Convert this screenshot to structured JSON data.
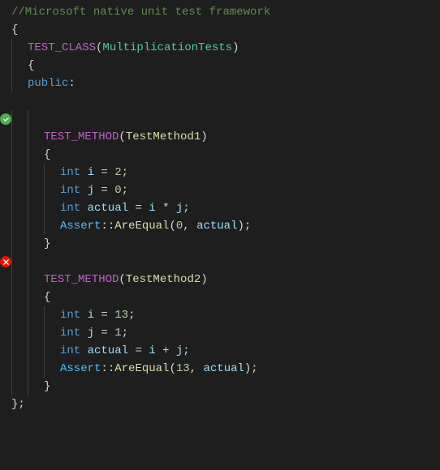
{
  "editor": {
    "background": "#1e1e1e",
    "lines": [
      {
        "id": 1,
        "indent": 0,
        "indicator": null,
        "tokens": [
          {
            "type": "comment",
            "text": "//Microsoft native unit test framework"
          }
        ]
      },
      {
        "id": 2,
        "indent": 0,
        "indicator": null,
        "tokens": [
          {
            "type": "text",
            "text": "{"
          }
        ]
      },
      {
        "id": 3,
        "indent": 1,
        "indicator": null,
        "tokens": [
          {
            "type": "macro",
            "text": "TEST_CLASS"
          },
          {
            "type": "text",
            "text": "("
          },
          {
            "type": "class",
            "text": "MultiplicationTests"
          },
          {
            "type": "text",
            "text": ")"
          }
        ]
      },
      {
        "id": 4,
        "indent": 1,
        "indicator": null,
        "tokens": [
          {
            "type": "text",
            "text": "{"
          }
        ]
      },
      {
        "id": 5,
        "indent": 1,
        "indicator": null,
        "tokens": [
          {
            "type": "keyword",
            "text": "public"
          },
          {
            "type": "text",
            "text": ":"
          }
        ]
      },
      {
        "id": 6,
        "indent": 0,
        "indicator": null,
        "tokens": []
      },
      {
        "id": 7,
        "indent": 2,
        "indicator": "pass",
        "tokens": []
      },
      {
        "id": 8,
        "indent": 2,
        "indicator": null,
        "tokens": [
          {
            "type": "macro",
            "text": "TEST_METHOD"
          },
          {
            "type": "text",
            "text": "("
          },
          {
            "type": "method",
            "text": "TestMethod1"
          },
          {
            "type": "text",
            "text": ")"
          }
        ]
      },
      {
        "id": 9,
        "indent": 2,
        "indicator": null,
        "tokens": [
          {
            "type": "text",
            "text": "{"
          }
        ]
      },
      {
        "id": 10,
        "indent": 3,
        "indicator": null,
        "tokens": [
          {
            "type": "keyword",
            "text": "int"
          },
          {
            "type": "text",
            "text": " "
          },
          {
            "type": "var",
            "text": "i"
          },
          {
            "type": "text",
            "text": " = "
          },
          {
            "type": "number",
            "text": "2"
          },
          {
            "type": "text",
            "text": ";"
          }
        ]
      },
      {
        "id": 11,
        "indent": 3,
        "indicator": null,
        "tokens": [
          {
            "type": "keyword",
            "text": "int"
          },
          {
            "type": "text",
            "text": " "
          },
          {
            "type": "var",
            "text": "j"
          },
          {
            "type": "text",
            "text": " = "
          },
          {
            "type": "number",
            "text": "0"
          },
          {
            "type": "text",
            "text": ";"
          }
        ]
      },
      {
        "id": 12,
        "indent": 3,
        "indicator": null,
        "tokens": [
          {
            "type": "keyword",
            "text": "int"
          },
          {
            "type": "text",
            "text": " "
          },
          {
            "type": "var",
            "text": "actual"
          },
          {
            "type": "text",
            "text": " = "
          },
          {
            "type": "var",
            "text": "i"
          },
          {
            "type": "text",
            "text": " * "
          },
          {
            "type": "var",
            "text": "j"
          },
          {
            "type": "text",
            "text": ";"
          }
        ]
      },
      {
        "id": 13,
        "indent": 3,
        "indicator": null,
        "tokens": [
          {
            "type": "assert",
            "text": "Assert"
          },
          {
            "type": "text",
            "text": "::"
          },
          {
            "type": "method",
            "text": "AreEqual"
          },
          {
            "type": "text",
            "text": "("
          },
          {
            "type": "number",
            "text": "0"
          },
          {
            "type": "text",
            "text": ", "
          },
          {
            "type": "var",
            "text": "actual"
          },
          {
            "type": "text",
            "text": ");"
          }
        ]
      },
      {
        "id": 14,
        "indent": 2,
        "indicator": null,
        "tokens": [
          {
            "type": "text",
            "text": "}"
          }
        ]
      },
      {
        "id": 15,
        "indent": 2,
        "indicator": "fail",
        "tokens": []
      },
      {
        "id": 16,
        "indent": 2,
        "indicator": null,
        "tokens": [
          {
            "type": "macro",
            "text": "TEST_METHOD"
          },
          {
            "type": "text",
            "text": "("
          },
          {
            "type": "method",
            "text": "TestMethod2"
          },
          {
            "type": "text",
            "text": ")"
          }
        ]
      },
      {
        "id": 17,
        "indent": 2,
        "indicator": null,
        "tokens": [
          {
            "type": "text",
            "text": "{"
          }
        ]
      },
      {
        "id": 18,
        "indent": 3,
        "indicator": null,
        "tokens": [
          {
            "type": "keyword",
            "text": "int"
          },
          {
            "type": "text",
            "text": " "
          },
          {
            "type": "var",
            "text": "i"
          },
          {
            "type": "text",
            "text": " = "
          },
          {
            "type": "number",
            "text": "13"
          },
          {
            "type": "text",
            "text": ";"
          }
        ]
      },
      {
        "id": 19,
        "indent": 3,
        "indicator": null,
        "tokens": [
          {
            "type": "keyword",
            "text": "int"
          },
          {
            "type": "text",
            "text": " "
          },
          {
            "type": "var",
            "text": "j"
          },
          {
            "type": "text",
            "text": " = "
          },
          {
            "type": "number",
            "text": "1"
          },
          {
            "type": "text",
            "text": ";"
          }
        ]
      },
      {
        "id": 20,
        "indent": 3,
        "indicator": null,
        "tokens": [
          {
            "type": "keyword",
            "text": "int"
          },
          {
            "type": "text",
            "text": " "
          },
          {
            "type": "var",
            "text": "actual"
          },
          {
            "type": "text",
            "text": " = "
          },
          {
            "type": "var",
            "text": "i"
          },
          {
            "type": "text",
            "text": " + "
          },
          {
            "type": "var",
            "text": "j"
          },
          {
            "type": "text",
            "text": ";"
          }
        ]
      },
      {
        "id": 21,
        "indent": 3,
        "indicator": null,
        "tokens": [
          {
            "type": "assert",
            "text": "Assert"
          },
          {
            "type": "text",
            "text": "::"
          },
          {
            "type": "method",
            "text": "AreEqual"
          },
          {
            "type": "text",
            "text": "("
          },
          {
            "type": "number",
            "text": "13"
          },
          {
            "type": "text",
            "text": ", "
          },
          {
            "type": "var",
            "text": "actual"
          },
          {
            "type": "text",
            "text": ");"
          }
        ]
      },
      {
        "id": 22,
        "indent": 2,
        "indicator": null,
        "tokens": [
          {
            "type": "text",
            "text": "}"
          }
        ]
      },
      {
        "id": 23,
        "indent": 0,
        "indicator": null,
        "tokens": [
          {
            "type": "text",
            "text": "};"
          }
        ]
      }
    ]
  }
}
